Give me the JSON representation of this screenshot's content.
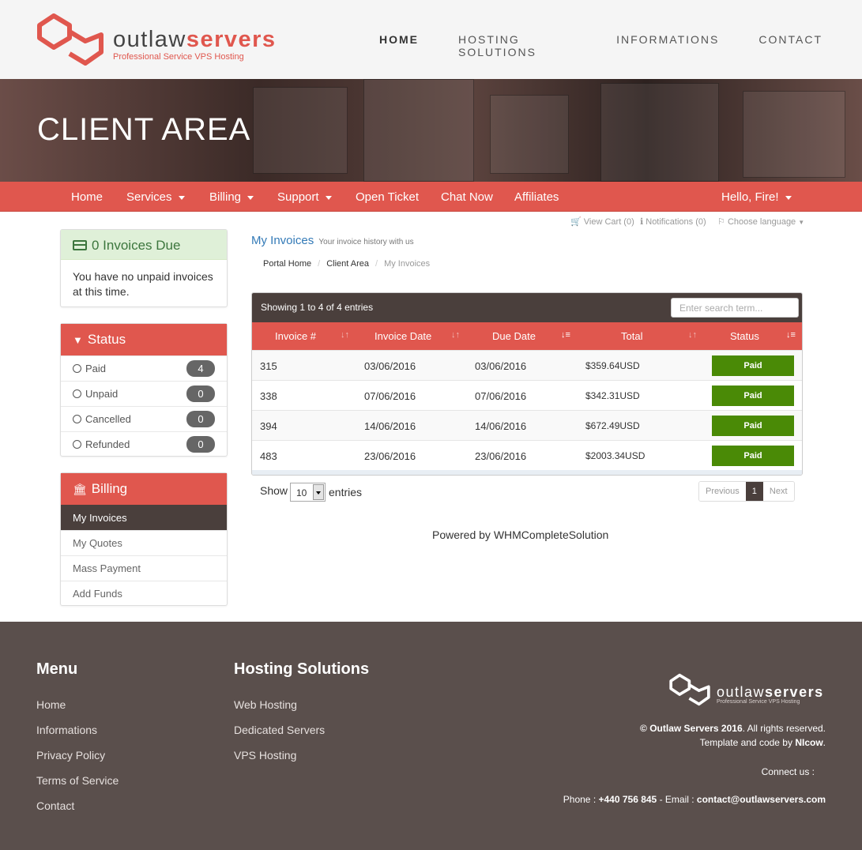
{
  "brand": {
    "name_light": "outlaw",
    "name_bold": "servers",
    "tagline": "Professional Service VPS Hosting",
    "accent": "#e0574e",
    "dark": "#4a3f3c"
  },
  "top_nav": [
    {
      "label": "HOME",
      "active": true
    },
    {
      "label": "HOSTING SOLUTIONS"
    },
    {
      "label": "INFORMATIONS"
    },
    {
      "label": "CONTACT"
    }
  ],
  "banner_title": "CLIENT AREA",
  "client_nav": {
    "home": "Home",
    "services": "Services",
    "billing": "Billing",
    "support": "Support",
    "open_ticket": "Open Ticket",
    "chat_now": "Chat Now",
    "affiliates": "Affiliates",
    "hello": "Hello, Fire!"
  },
  "utility": {
    "view_cart": "View Cart (0)",
    "notifications": "Notifications (0)",
    "language": "Choose language"
  },
  "invoices_due": {
    "title": "0 Invoices Due",
    "text": "You have no unpaid invoices at this time."
  },
  "status_panel": {
    "title": "Status",
    "items": [
      {
        "label": "Paid",
        "count": "4"
      },
      {
        "label": "Unpaid",
        "count": "0"
      },
      {
        "label": "Cancelled",
        "count": "0"
      },
      {
        "label": "Refunded",
        "count": "0"
      }
    ]
  },
  "billing_panel": {
    "title": "Billing",
    "items": [
      {
        "label": "My Invoices",
        "active": true
      },
      {
        "label": "My Quotes"
      },
      {
        "label": "Mass Payment"
      },
      {
        "label": "Add Funds"
      }
    ]
  },
  "page": {
    "title": "My Invoices",
    "subtitle": "Your invoice history with us"
  },
  "breadcrumb": [
    "Portal Home",
    "Client Area",
    "My Invoices"
  ],
  "table": {
    "info": "Showing 1 to 4 of 4 entries",
    "search_placeholder": "Enter search term...",
    "headers": [
      "Invoice #",
      "Invoice Date",
      "Due Date",
      "Total",
      "Status"
    ],
    "rows": [
      {
        "invoice": "315",
        "date": "03/06/2016",
        "due": "03/06/2016",
        "total": "$359.64USD",
        "status": "Paid"
      },
      {
        "invoice": "338",
        "date": "07/06/2016",
        "due": "07/06/2016",
        "total": "$342.31USD",
        "status": "Paid"
      },
      {
        "invoice": "394",
        "date": "14/06/2016",
        "due": "14/06/2016",
        "total": "$672.49USD",
        "status": "Paid"
      },
      {
        "invoice": "483",
        "date": "23/06/2016",
        "due": "23/06/2016",
        "total": "$2003.34USD",
        "status": "Paid"
      }
    ],
    "show_label": "Show",
    "page_size": "10",
    "entries_label": "entries",
    "pager": {
      "previous": "Previous",
      "current": "1",
      "next": "Next"
    }
  },
  "powered_by": "Powered by WHMCompleteSolution",
  "footer": {
    "menu_title": "Menu",
    "menu": [
      "Home",
      "Informations",
      "Privacy Policy",
      "Terms of Service",
      "Contact"
    ],
    "hosting_title": "Hosting Solutions",
    "hosting": [
      "Web Hosting",
      "Dedicated Servers",
      "VPS Hosting"
    ],
    "copyright_bold": "© Outlaw Servers 2016",
    "copyright_rest": ". All rights reserved.",
    "template_text": "Template and code by ",
    "template_author": "NIcow",
    "template_end": ".",
    "connect": "Connect us :",
    "phone_label": "Phone : ",
    "phone": "+440 756 845",
    "email_label": " - Email : ",
    "email": "contact@outlawservers.com"
  }
}
